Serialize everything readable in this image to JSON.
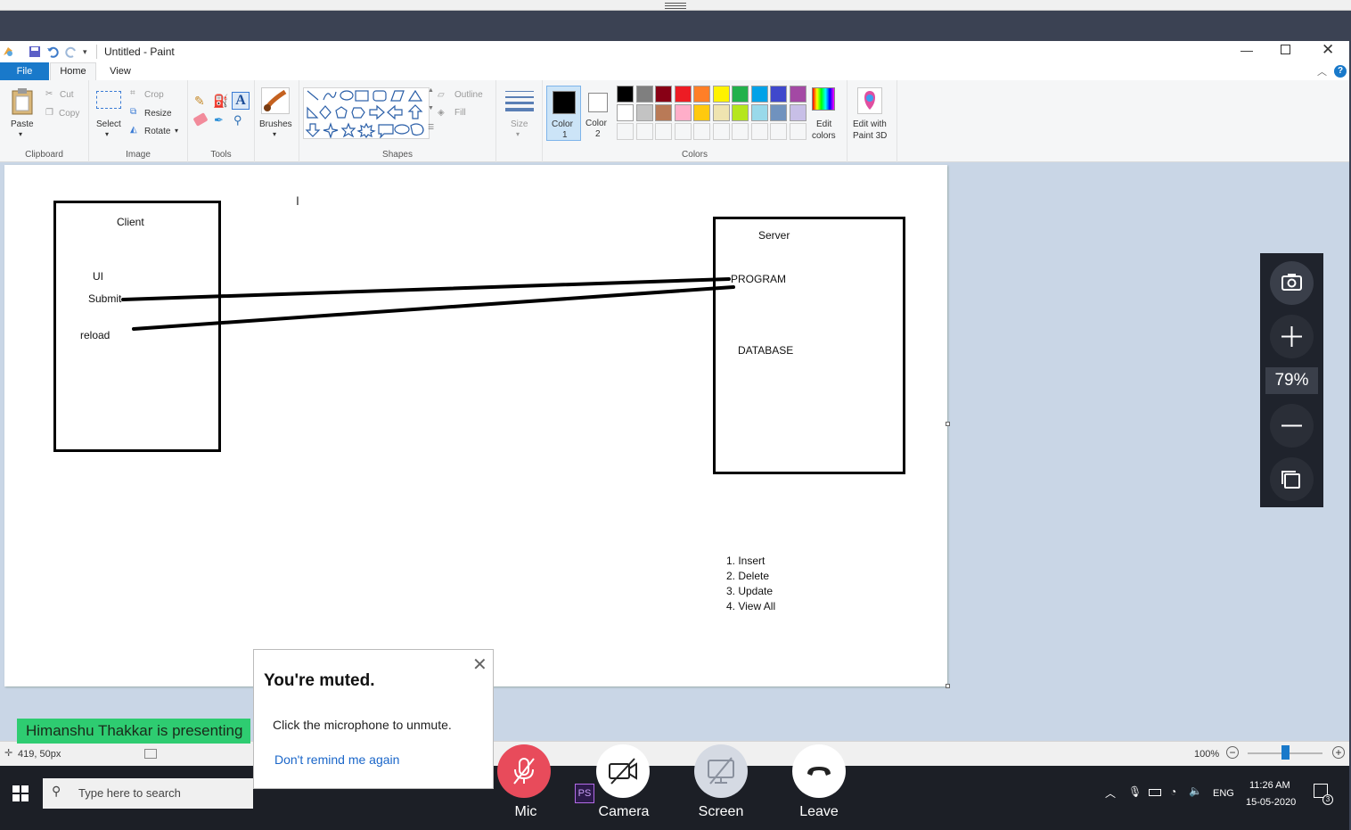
{
  "window": {
    "title": "Untitled - Paint"
  },
  "menu": {
    "file": "File",
    "home": "Home",
    "view": "View"
  },
  "ribbon": {
    "clipboard": {
      "paste": "Paste",
      "cut": "Cut",
      "copy": "Copy",
      "label": "Clipboard"
    },
    "image": {
      "select": "Select",
      "crop": "Crop",
      "resize": "Resize",
      "rotate": "Rotate",
      "label": "Image"
    },
    "tools": {
      "label": "Tools"
    },
    "brushes": {
      "label": "Brushes"
    },
    "shapes": {
      "outline": "Outline",
      "fill": "Fill",
      "label": "Shapes"
    },
    "size": {
      "label": "Size"
    },
    "colors": {
      "color1": "Color",
      "color1_num": "1",
      "color2": "Color",
      "color2_num": "2",
      "edit_colors_1": "Edit",
      "edit_colors_2": "colors",
      "label": "Colors",
      "row1": [
        "#000000",
        "#7f7f7f",
        "#880015",
        "#ed1c24",
        "#ff7f27",
        "#fff200",
        "#22b14c",
        "#00a2e8",
        "#3f48cc",
        "#a349a4"
      ],
      "row2": [
        "#ffffff",
        "#c3c3c3",
        "#b97a57",
        "#ffaec9",
        "#ffc90e",
        "#efe4b0",
        "#b5e61d",
        "#99d9ea",
        "#7092be",
        "#c8bfe7"
      ]
    },
    "paint3d": {
      "line1": "Edit with",
      "line2": "Paint 3D"
    }
  },
  "canvas": {
    "client": {
      "title": "Client",
      "ui": "UI",
      "submit": "Submit",
      "reload": "reload"
    },
    "server": {
      "title": "Server",
      "program": "PROGRAM",
      "database": "DATABASE"
    },
    "ops": [
      "1. Insert",
      "2. Delete",
      "3. Update",
      "4. View All"
    ]
  },
  "statusbar": {
    "position": "419, 50px",
    "zoom": "100%"
  },
  "meeting": {
    "presenting": "Himanshu Thakkar is presenting",
    "muted_title": "You're muted.",
    "muted_body": "Click the microphone to unmute.",
    "muted_link": "Don't remind me again",
    "mic": "Mic",
    "camera": "Camera",
    "screen": "Screen",
    "leave": "Leave",
    "zoom_level": "79%"
  },
  "taskbar": {
    "search_placeholder": "Type here to search",
    "lang": "ENG",
    "time": "11:26 AM",
    "date": "15-05-2020",
    "notif_count": "3"
  }
}
